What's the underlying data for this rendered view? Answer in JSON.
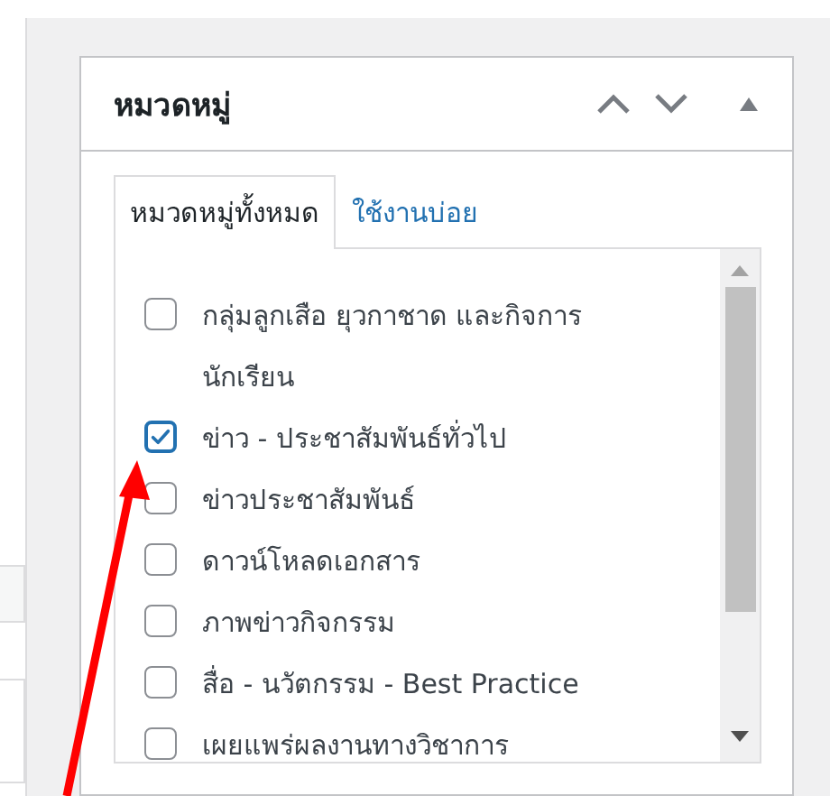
{
  "metabox": {
    "title": "หมวดหมู่",
    "tabs": [
      {
        "label": "หมวดหมู่ทั้งหมด",
        "selected": true
      },
      {
        "label": "ใช้งานบ่อย",
        "selected": false
      }
    ],
    "categories": [
      {
        "label": "กลุ่มลูกเสือ ยุวกาชาด และกิจการ นักเรียน",
        "checked": false
      },
      {
        "label": "ข่าว - ประชาสัมพันธ์ทั่วไป",
        "checked": true
      },
      {
        "label": "ข่าวประชาสัมพันธ์",
        "checked": false
      },
      {
        "label": "ดาวน์โหลดเอกสาร",
        "checked": false
      },
      {
        "label": "ภาพข่าวกิจกรรม",
        "checked": false
      },
      {
        "label": "สื่อ - นวัตกรรม - Best Practice",
        "checked": false
      },
      {
        "label": "เผยแพร่ผลงานทางวิชาการ",
        "checked": false
      }
    ]
  }
}
